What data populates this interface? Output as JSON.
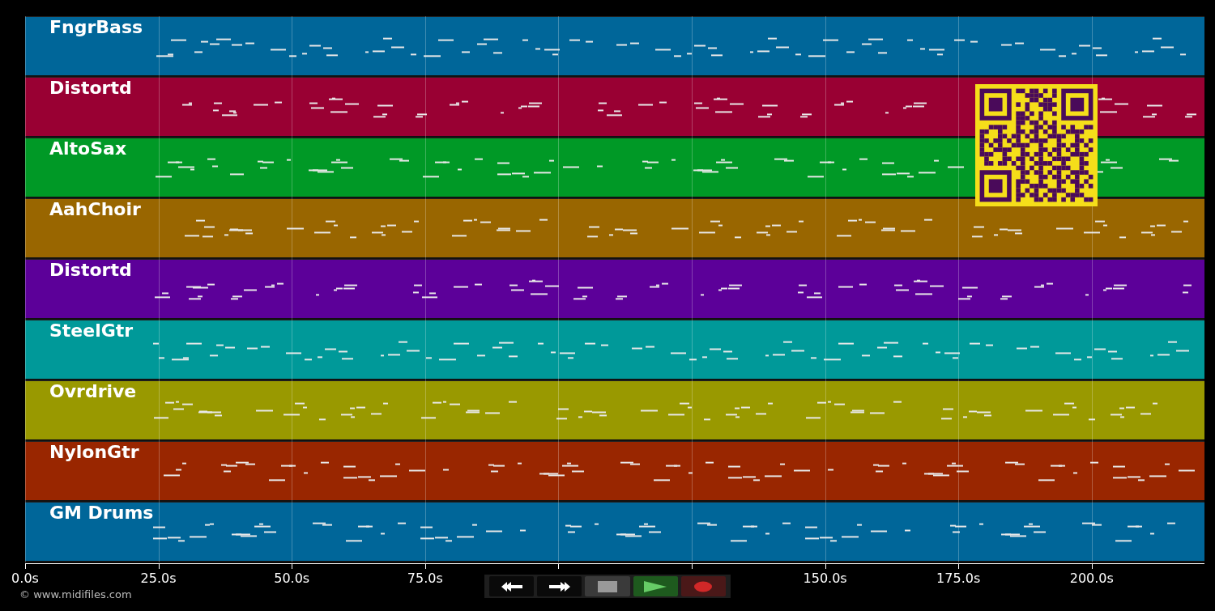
{
  "tracks": [
    {
      "name": "FngrBass",
      "color": "#006699"
    },
    {
      "name": "Distortd",
      "color": "#990033"
    },
    {
      "name": "AltoSax",
      "color": "#009926"
    },
    {
      "name": "AahChoir",
      "color": "#996600"
    },
    {
      "name": "Distortd",
      "color": "#5c0099"
    },
    {
      "name": "SteelGtr",
      "color": "#009999"
    },
    {
      "name": "Ovrdrive",
      "color": "#999900"
    },
    {
      "name": "NylonGtr",
      "color": "#992600"
    },
    {
      "name": "GM Drums",
      "color": "#006699"
    }
  ],
  "time_axis": {
    "ticks": [
      {
        "kind": "labeled",
        "label": "0.0s"
      },
      {
        "kind": "labeled",
        "label": "25.0s"
      },
      {
        "kind": "labeled",
        "label": "50.0s"
      },
      {
        "kind": "labeled",
        "label": "75.0s"
      },
      {
        "kind": "covered"
      },
      {
        "kind": "covered"
      },
      {
        "kind": "labeled",
        "label": "150.0s"
      },
      {
        "kind": "labeled",
        "label": "175.0s"
      },
      {
        "kind": "labeled",
        "label": "200.0s"
      }
    ]
  },
  "footer": {
    "copyright": "© www.midifiles.com"
  }
}
